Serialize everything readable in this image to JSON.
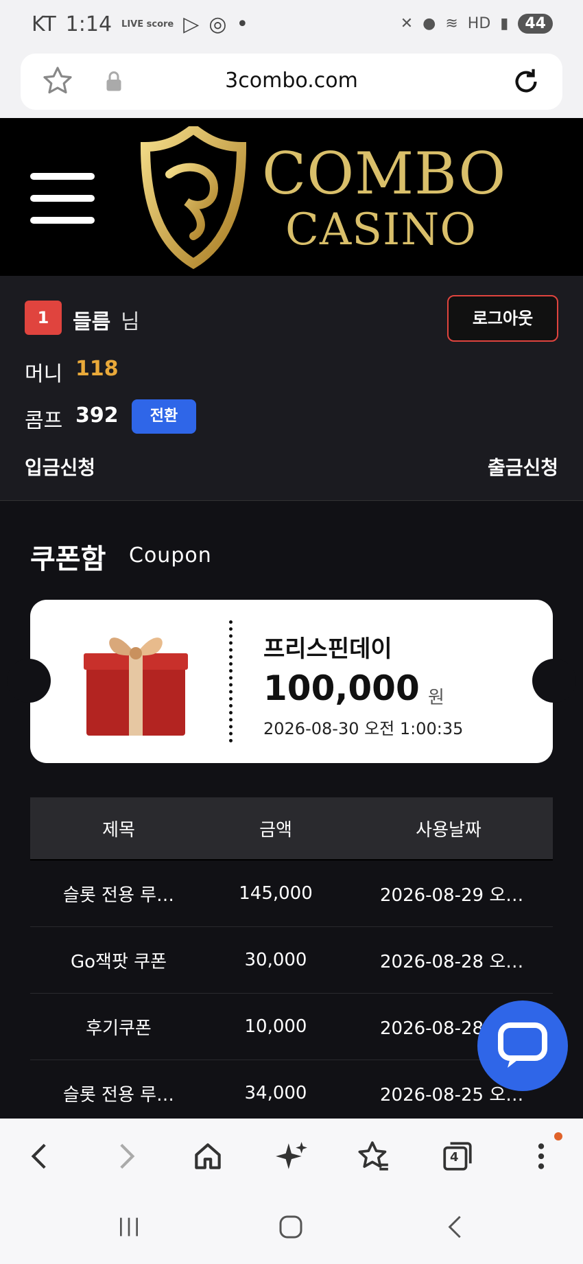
{
  "status_bar": {
    "carrier": "KT",
    "time": "1:14",
    "live_badge": "LIVE score",
    "battery": "44"
  },
  "browser": {
    "url": "3combo.com",
    "tabs_count": "4"
  },
  "header": {
    "logo_line1": "COMBO",
    "logo_line2": "CASINO"
  },
  "user": {
    "level": "1",
    "name": "들름",
    "suffix": "님",
    "logout_label": "로그아웃",
    "money_label": "머니",
    "money_value": "118",
    "comp_label": "콤프",
    "comp_value": "392",
    "convert_label": "전환",
    "deposit_label": "입금신청",
    "withdraw_label": "출금신청"
  },
  "coupon_section": {
    "title": "쿠폰함",
    "subtitle": "Coupon",
    "card": {
      "name": "프리스핀데이",
      "amount": "100,000",
      "unit": "원",
      "date": "2026-08-30 오전 1:00:35"
    },
    "table": {
      "headers": [
        "제목",
        "금액",
        "사용날짜"
      ],
      "rows": [
        {
          "title": "슬롯 전용 루…",
          "amount": "145,000",
          "date": "2026-08-29 오…"
        },
        {
          "title": "Go잭팟 쿠폰",
          "amount": "30,000",
          "date": "2026-08-28 오…"
        },
        {
          "title": "후기쿠폰",
          "amount": "10,000",
          "date": "2026-08-28 오…"
        },
        {
          "title": "슬롯 전용 루…",
          "amount": "34,000",
          "date": "2026-08-25 오…"
        }
      ]
    }
  },
  "colors": {
    "accent_red": "#e0443e",
    "accent_blue": "#2f66e8",
    "money_gold": "#e9a93a",
    "logo_gold": "#d9bf6a"
  },
  "icons": [
    "star-icon",
    "lock-icon",
    "reload-icon",
    "hamburger-icon",
    "chat-icon",
    "back-icon",
    "forward-icon",
    "home-icon",
    "sparkle-icon",
    "bookmarks-icon",
    "tabs-icon",
    "more-icon"
  ]
}
